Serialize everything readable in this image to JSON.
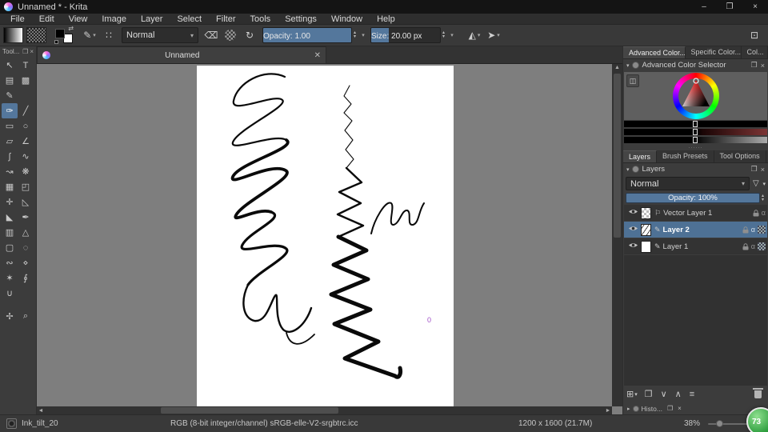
{
  "window": {
    "title": "Unnamed * - Krita",
    "minimize": "–",
    "maximize": "❐",
    "close": "×"
  },
  "menu": {
    "items": [
      {
        "label": "File",
        "name": "menu-file"
      },
      {
        "label": "Edit",
        "name": "menu-edit"
      },
      {
        "label": "View",
        "name": "menu-view"
      },
      {
        "label": "Image",
        "name": "menu-image"
      },
      {
        "label": "Layer",
        "name": "menu-layer"
      },
      {
        "label": "Select",
        "name": "menu-select"
      },
      {
        "label": "Filter",
        "name": "menu-filter"
      },
      {
        "label": "Tools",
        "name": "menu-tools"
      },
      {
        "label": "Settings",
        "name": "menu-settings"
      },
      {
        "label": "Window",
        "name": "menu-window"
      },
      {
        "label": "Help",
        "name": "menu-help"
      }
    ]
  },
  "toolbar": {
    "blending_mode": "Normal",
    "opacity_label": "Opacity:  1.00",
    "size_label": "Size:  20.00 px",
    "brush_glyph": "✎",
    "presets_glyph": "∷",
    "eraser_glyph": "⌫",
    "reload_glyph": "↻",
    "mirror_h_glyph": "◭",
    "wrap_glyph": "➤",
    "workspace_glyph": "⊡",
    "swap_glyph": "⇄",
    "dropdown_glyph": "▾",
    "spin_up": "▴",
    "spin_down": "▾"
  },
  "toolbox": {
    "title": "Tool...",
    "float_glyph": "❐",
    "close_glyph": "×",
    "tools": [
      {
        "name": "tool-select-shapes",
        "glyph": "↖",
        "state": ""
      },
      {
        "name": "tool-text",
        "glyph": "T",
        "state": ""
      },
      {
        "name": "tool-edit-shapes",
        "glyph": "▤",
        "state": ""
      },
      {
        "name": "tool-calligraphy",
        "glyph": "▩",
        "state": ""
      },
      {
        "name": "tool-pencil",
        "glyph": "✎",
        "state": ""
      },
      {
        "name": "tool-blank-1",
        "glyph": "",
        "state": "blank"
      },
      {
        "name": "tool-freehand-brush",
        "glyph": "✑",
        "state": "selected"
      },
      {
        "name": "tool-line",
        "glyph": "╱",
        "state": ""
      },
      {
        "name": "tool-rectangle",
        "glyph": "▭",
        "state": ""
      },
      {
        "name": "tool-ellipse",
        "glyph": "○",
        "state": ""
      },
      {
        "name": "tool-polygon",
        "glyph": "▱",
        "state": ""
      },
      {
        "name": "tool-polyline",
        "glyph": "∠",
        "state": ""
      },
      {
        "name": "tool-bezier-curve",
        "glyph": "∫",
        "state": ""
      },
      {
        "name": "tool-freehand-path",
        "glyph": "∿",
        "state": ""
      },
      {
        "name": "tool-dynamic-brush",
        "glyph": "↝",
        "state": ""
      },
      {
        "name": "tool-multibrush",
        "glyph": "❋",
        "state": ""
      },
      {
        "name": "tool-crop",
        "glyph": "▦",
        "state": ""
      },
      {
        "name": "tool-transform",
        "glyph": "◰",
        "state": ""
      },
      {
        "name": "tool-move",
        "glyph": "✛",
        "state": ""
      },
      {
        "name": "tool-measure",
        "glyph": "◺",
        "state": ""
      },
      {
        "name": "tool-fill",
        "glyph": "◣",
        "state": ""
      },
      {
        "name": "tool-color-sampler",
        "glyph": "✒",
        "state": ""
      },
      {
        "name": "tool-gradient",
        "glyph": "▥",
        "state": ""
      },
      {
        "name": "tool-assistants",
        "glyph": "△",
        "state": ""
      },
      {
        "name": "tool-rect-select",
        "glyph": "▢",
        "state": ""
      },
      {
        "name": "tool-ellipse-select",
        "glyph": "◌",
        "state": ""
      },
      {
        "name": "tool-freehand-select",
        "glyph": "∾",
        "state": ""
      },
      {
        "name": "tool-polygonal-select",
        "glyph": "⋄",
        "state": ""
      },
      {
        "name": "tool-similar-select",
        "glyph": "✶",
        "state": ""
      },
      {
        "name": "tool-bezier-select",
        "glyph": "∮",
        "state": ""
      },
      {
        "name": "tool-magnetic-select",
        "glyph": "∪",
        "state": ""
      },
      {
        "name": "tool-blank-2",
        "glyph": "",
        "state": "blank"
      },
      {
        "name": "tool-pan",
        "glyph": "✢",
        "state": "gap-top"
      },
      {
        "name": "tool-zoom",
        "glyph": "⌕",
        "state": "gap-top"
      }
    ]
  },
  "canvas": {
    "tab_label": "Unnamed",
    "tab_close": "✕",
    "annotation": "0"
  },
  "color_docker": {
    "tabs": [
      {
        "label": "Advanced Color...",
        "state": "active",
        "name": "tab-advanced-color"
      },
      {
        "label": "Specific Color...",
        "state": "",
        "name": "tab-specific-color"
      },
      {
        "label": "Col...",
        "state": "",
        "name": "tab-col"
      }
    ],
    "title": "Advanced Color Selector",
    "collapse_glyph": "▾",
    "float_glyph": "❐",
    "close_glyph": "×",
    "settings_glyph": "◫"
  },
  "layers_docker": {
    "tabs": [
      {
        "label": "Layers",
        "state": "active",
        "name": "tab-layers"
      },
      {
        "label": "Brush Presets",
        "state": "",
        "name": "tab-brush-presets"
      },
      {
        "label": "Tool Options",
        "state": "",
        "name": "tab-tool-options"
      }
    ],
    "title": "Layers",
    "blend_mode": "Normal",
    "filter_glyph": "▽",
    "opacity_label": "Opacity:  100%",
    "alpha_glyph": "α",
    "layers": [
      {
        "name": "Vector Layer 1",
        "thumb": "checker",
        "type_glyph": "⚐",
        "state": "",
        "extra": ""
      },
      {
        "name": "Layer 2",
        "thumb": "scribble",
        "type_glyph": "✎",
        "state": "selected",
        "extra": "checker"
      },
      {
        "name": "Layer 1",
        "thumb": "white",
        "type_glyph": "✎",
        "state": "",
        "extra": "checker"
      }
    ],
    "buttons": [
      {
        "name": "add-layer-button",
        "glyph": "⊞",
        "dd": "▾"
      },
      {
        "name": "duplicate-layer-button",
        "glyph": "❐",
        "dd": ""
      },
      {
        "name": "move-layer-down-button",
        "glyph": "∨",
        "dd": ""
      },
      {
        "name": "move-layer-up-button",
        "glyph": "∧",
        "dd": ""
      },
      {
        "name": "layer-properties-button",
        "glyph": "≡",
        "dd": ""
      }
    ]
  },
  "histogram_docker": {
    "label": "Histo...",
    "collapse_glyph": "▸",
    "float_glyph": "❐",
    "close_glyph": "×"
  },
  "statusbar": {
    "preset_name": "Ink_tilt_20",
    "colorspace": "RGB (8-bit integer/channel)  sRGB-elle-V2-srgbtrc.icc",
    "dimensions": "1200 x 1600 (21.7M)",
    "zoom": "38%",
    "angle_badge": "73"
  },
  "colors": {
    "accent": "#54779c",
    "viewport": "#7e7e7e",
    "selection_blue": "#4e7195"
  }
}
